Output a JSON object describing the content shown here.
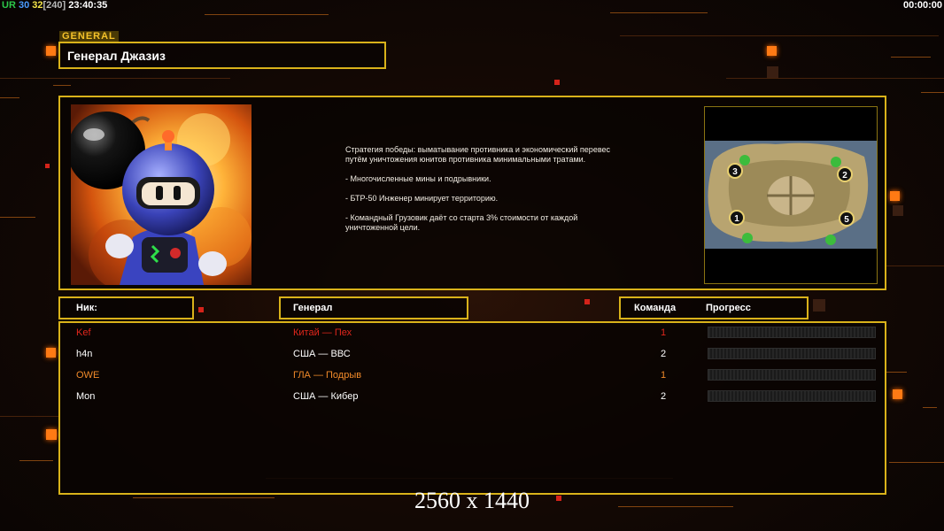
{
  "topbar": {
    "ur": "UR",
    "v1": "30",
    "v2": "32",
    "v3": "[240]",
    "clock": "23:40:35",
    "timer": "00:00:00"
  },
  "general": {
    "tag": "GENERAL",
    "name": "Генерал Джазиз",
    "description": [
      "Стратегия победы: выматывание противника и экономический перевес путём уничтожения юнитов противника минимальными тратами.",
      "- Многочисленные мины и подрывники.",
      "- БТР-50 Инженер минирует территорию.",
      "- Командный Грузовик даёт со старта 3% стоимости от каждой уничтоженной цели."
    ],
    "portrait_icon": "bomberman-portrait",
    "minimap": {
      "icon": "island-map",
      "slots": [
        "3",
        "2",
        "1",
        "5"
      ]
    }
  },
  "headers": {
    "nick": "Ник:",
    "general": "Генерал",
    "team": "Команда",
    "progress": "Прогресс"
  },
  "players": [
    {
      "nick": "Kef",
      "general": "Китай — Пех",
      "team": "1",
      "progress": 0,
      "color": "#e0261c"
    },
    {
      "nick": "h4n",
      "general": "США — ВВС",
      "team": "2",
      "progress": 0,
      "color": "#ffffff"
    },
    {
      "nick": "OWE",
      "general": "ГЛА — Подрыв",
      "team": "1",
      "progress": 0,
      "color": "#f08a2a"
    },
    {
      "nick": "Mon",
      "general": "США — Кибер",
      "team": "2",
      "progress": 0,
      "color": "#ffffff"
    }
  ],
  "overlay": {
    "resolution": "2560 x 1440"
  }
}
